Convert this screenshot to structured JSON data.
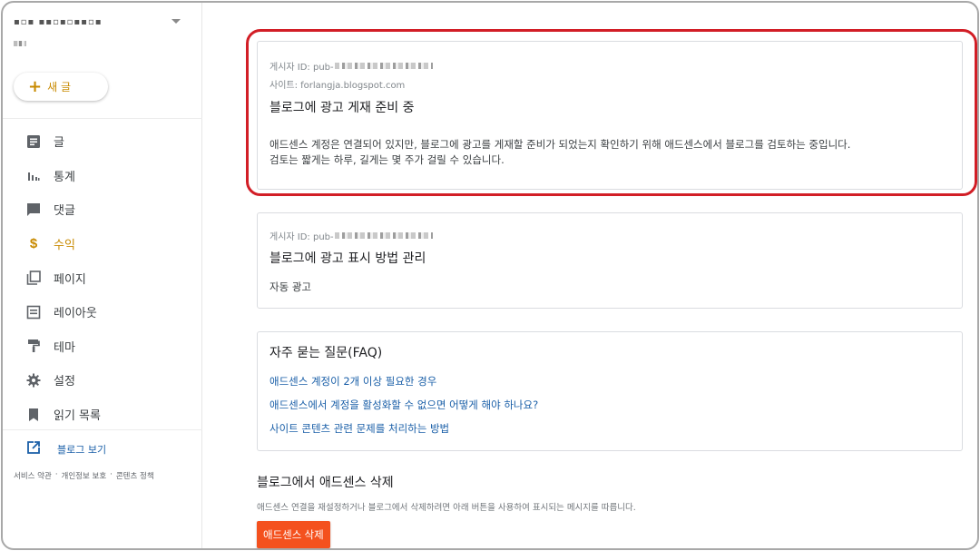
{
  "sidebar": {
    "blog_name": "▪▫▪ ▪▪▫▪▫▪▪▫▪",
    "new_post_label": "새 글",
    "items": [
      {
        "label": "글",
        "icon": "posts-icon",
        "active": false
      },
      {
        "label": "통계",
        "icon": "stats-icon",
        "active": false
      },
      {
        "label": "댓글",
        "icon": "comments-icon",
        "active": false
      },
      {
        "label": "수익",
        "icon": "dollar-icon",
        "active": true
      },
      {
        "label": "페이지",
        "icon": "pages-icon",
        "active": false
      },
      {
        "label": "레이아웃",
        "icon": "layout-icon",
        "active": false
      },
      {
        "label": "테마",
        "icon": "theme-brush-icon",
        "active": false
      },
      {
        "label": "설정",
        "icon": "gear-icon",
        "active": false
      },
      {
        "label": "읽기 목록",
        "icon": "bookmark-icon",
        "active": false
      }
    ],
    "view_blog_label": "블로그 보기",
    "footer_links": [
      "서비스 약관",
      "개인정보 보호",
      "콘텐츠 정책"
    ],
    "footer_separator": "·"
  },
  "adsense_status": {
    "publisher_id_label": "게시자 ID: pub-",
    "site_label": "사이트: forlangja.blogspot.com",
    "title": "블로그에 광고 게재 준비 중",
    "description_line1": "애드센스 계정은 연결되어 있지만, 블로그에 광고를 게재할 준비가 되었는지 확인하기 위해 애드센스에서 블로그를 검토하는 중입니다.",
    "description_line2": "검토는 짧게는 하루, 길게는 몇 주가 걸릴 수 있습니다."
  },
  "ad_display": {
    "publisher_id_label": "게시자 ID: pub-",
    "title": "블로그에 광고 표시 방법 관리",
    "auto_ads_label": "자동 광고"
  },
  "faq": {
    "title": "자주 묻는 질문(FAQ)",
    "links": [
      "애드센스 계정이 2개 이상 필요한 경우",
      "애드센스에서 계정을 활성화할 수 없으면 어떻게 해야 하나요?",
      "사이트 콘텐츠 관련 문제를 처리하는 방법"
    ]
  },
  "remove_adsense": {
    "title": "블로그에서 애드센스 삭제",
    "description": "애드센스 연결을 재설정하거나 블로그에서 삭제하려면 아래 버튼을 사용하여 표시되는 메시지를 따릅니다.",
    "button_label": "애드센스 삭제"
  },
  "colors": {
    "accent": "#c88a00",
    "link": "#1a5fa8",
    "delete_button": "#f4511e",
    "highlight_outline": "#d21e26"
  }
}
